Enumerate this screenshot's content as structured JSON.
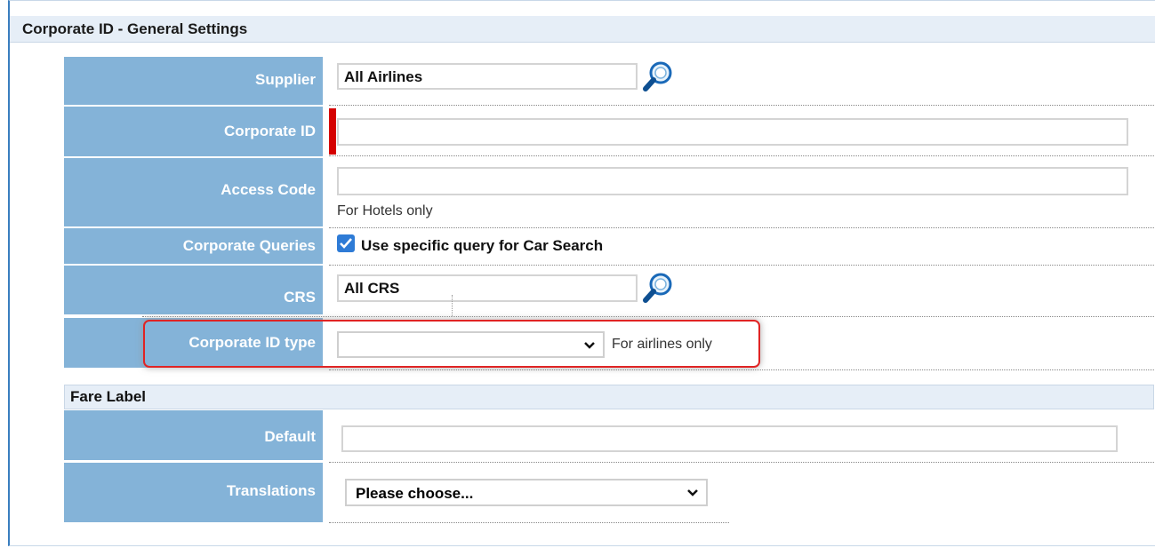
{
  "section": {
    "title": "Corporate ID - General Settings"
  },
  "fields": {
    "supplier": {
      "label": "Supplier",
      "value": "All Airlines"
    },
    "corporate_id": {
      "label": "Corporate ID",
      "value": ""
    },
    "access_code": {
      "label": "Access Code",
      "value": "",
      "hint": "For Hotels only"
    },
    "corporate_queries": {
      "label": "Corporate Queries",
      "checkbox_label": "Use specific query for Car Search",
      "checked": true
    },
    "crs": {
      "label": "CRS",
      "value": "All CRS"
    },
    "corporate_id_type": {
      "label": "Corporate ID type",
      "value": "",
      "hint": "For airlines only"
    }
  },
  "fare_label": {
    "title": "Fare Label",
    "default": {
      "label": "Default",
      "value": ""
    },
    "translations": {
      "label": "Translations",
      "value": "Please choose..."
    }
  },
  "colors": {
    "label_bg": "#84b3d8",
    "header_bg": "#e6eef7",
    "required": "#d50000",
    "highlight": "#e02424",
    "checkbox": "#2e7bd6"
  }
}
